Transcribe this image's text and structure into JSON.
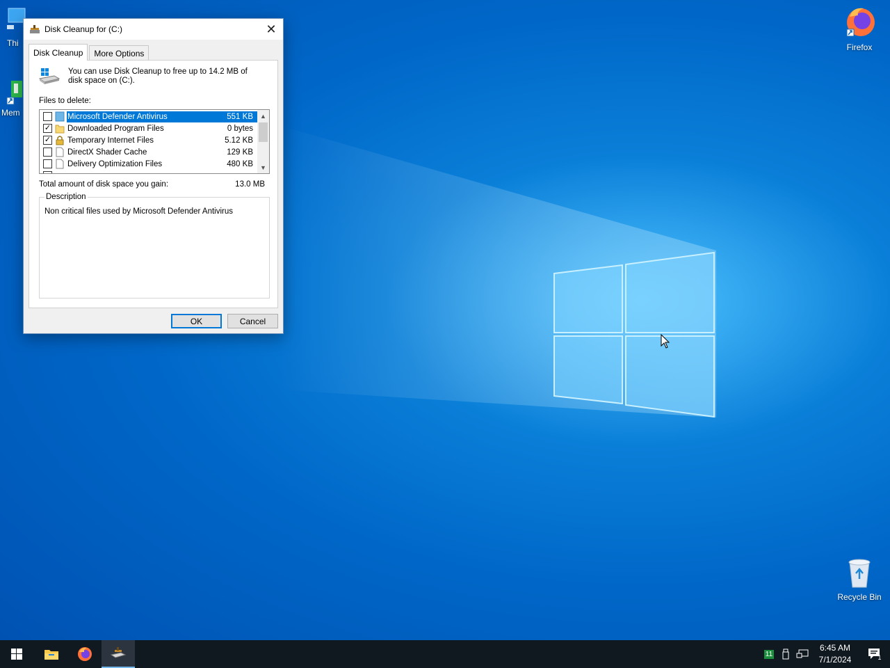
{
  "desktop": {
    "icons": [
      {
        "label": "Thi"
      },
      {
        "label": "Mem"
      },
      {
        "label": "Firefox"
      },
      {
        "label": "Recycle Bin"
      }
    ]
  },
  "dialog": {
    "title": "Disk Cleanup for  (C:)",
    "tabs": [
      "Disk Cleanup",
      "More Options"
    ],
    "intro": "You can use Disk Cleanup to free up to 14.2 MB of disk space on  (C:).",
    "files_label": "Files to delete:",
    "files": [
      {
        "name": "Microsoft Defender Antivirus",
        "size": "551 KB",
        "checked": false,
        "selected": true
      },
      {
        "name": "Downloaded Program Files",
        "size": "0 bytes",
        "checked": true,
        "selected": false
      },
      {
        "name": "Temporary Internet Files",
        "size": "5.12 KB",
        "checked": true,
        "selected": false
      },
      {
        "name": "DirectX Shader Cache",
        "size": "129 KB",
        "checked": false,
        "selected": false
      },
      {
        "name": "Delivery Optimization Files",
        "size": "480 KB",
        "checked": false,
        "selected": false
      }
    ],
    "total_label": "Total amount of disk space you gain:",
    "total_value": "13.0 MB",
    "description_label": "Description",
    "description_text": "Non critical files used by Microsoft Defender Antivirus",
    "ok_label": "OK",
    "cancel_label": "Cancel"
  },
  "taskbar": {
    "tray_badge": "11",
    "time": "6:45 AM",
    "date": "7/1/2024",
    "notification_count": "1"
  },
  "colors": {
    "accent": "#0078d7",
    "taskbar": "#101820",
    "desktop": "#0067c8"
  }
}
